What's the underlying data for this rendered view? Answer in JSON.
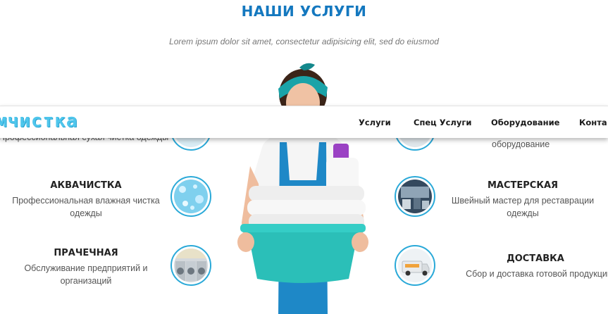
{
  "section": {
    "title": "НАШИ УСЛУГИ",
    "subtitle": "Lorem ipsum dolor sit amet, consectetur adipisicing elit, sed do eiusmod"
  },
  "nav": {
    "logo": "мчистка",
    "items": [
      {
        "label": "Услуги"
      },
      {
        "label": "Спец Услуги"
      },
      {
        "label": "Оборудование"
      },
      {
        "label": "Конта"
      }
    ]
  },
  "services_left": [
    {
      "title": "",
      "desc": "Профессиональная сухая чистка одежды"
    },
    {
      "title": "АКВАЧИСТКА",
      "desc": "Профессиональная влажная чистка одежды"
    },
    {
      "title": "ПРАЧЕЧНАЯ",
      "desc": "Обслуживание предприятий и организаций"
    }
  ],
  "services_right": [
    {
      "title": "",
      "desc": "оборудование"
    },
    {
      "title": "МАСТЕРСКАЯ",
      "desc": "Швейный мастер для реставрации одежды"
    },
    {
      "title": "ДОСТАВКА",
      "desc": "Сбор и доставка готовой продукции"
    }
  ],
  "colors": {
    "accent": "#1478bf",
    "circle_border": "#2aa9d8",
    "logo": "#4fc6ec",
    "apron": "#1e88c7",
    "basin": "#2bbfb8"
  }
}
